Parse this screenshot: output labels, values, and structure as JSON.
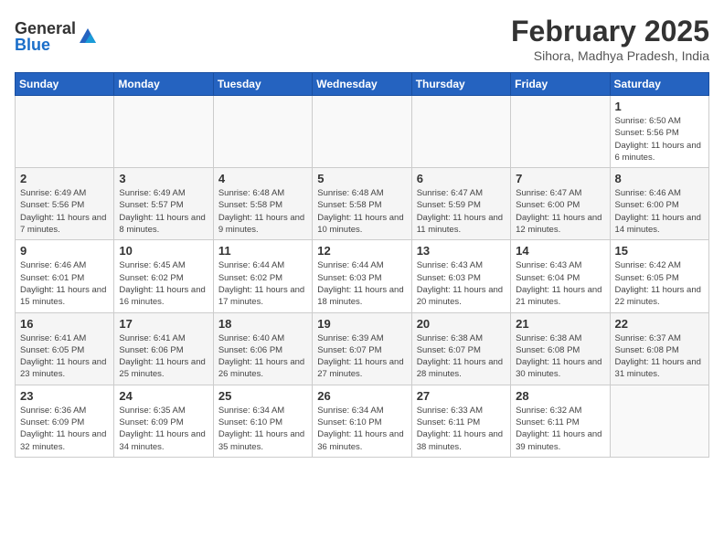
{
  "header": {
    "logo_general": "General",
    "logo_blue": "Blue",
    "month_title": "February 2025",
    "location": "Sihora, Madhya Pradesh, India"
  },
  "weekdays": [
    "Sunday",
    "Monday",
    "Tuesday",
    "Wednesday",
    "Thursday",
    "Friday",
    "Saturday"
  ],
  "weeks": [
    [
      {
        "day": "",
        "info": ""
      },
      {
        "day": "",
        "info": ""
      },
      {
        "day": "",
        "info": ""
      },
      {
        "day": "",
        "info": ""
      },
      {
        "day": "",
        "info": ""
      },
      {
        "day": "",
        "info": ""
      },
      {
        "day": "1",
        "info": "Sunrise: 6:50 AM\nSunset: 5:56 PM\nDaylight: 11 hours and 6 minutes."
      }
    ],
    [
      {
        "day": "2",
        "info": "Sunrise: 6:49 AM\nSunset: 5:56 PM\nDaylight: 11 hours and 7 minutes."
      },
      {
        "day": "3",
        "info": "Sunrise: 6:49 AM\nSunset: 5:57 PM\nDaylight: 11 hours and 8 minutes."
      },
      {
        "day": "4",
        "info": "Sunrise: 6:48 AM\nSunset: 5:58 PM\nDaylight: 11 hours and 9 minutes."
      },
      {
        "day": "5",
        "info": "Sunrise: 6:48 AM\nSunset: 5:58 PM\nDaylight: 11 hours and 10 minutes."
      },
      {
        "day": "6",
        "info": "Sunrise: 6:47 AM\nSunset: 5:59 PM\nDaylight: 11 hours and 11 minutes."
      },
      {
        "day": "7",
        "info": "Sunrise: 6:47 AM\nSunset: 6:00 PM\nDaylight: 11 hours and 12 minutes."
      },
      {
        "day": "8",
        "info": "Sunrise: 6:46 AM\nSunset: 6:00 PM\nDaylight: 11 hours and 14 minutes."
      }
    ],
    [
      {
        "day": "9",
        "info": "Sunrise: 6:46 AM\nSunset: 6:01 PM\nDaylight: 11 hours and 15 minutes."
      },
      {
        "day": "10",
        "info": "Sunrise: 6:45 AM\nSunset: 6:02 PM\nDaylight: 11 hours and 16 minutes."
      },
      {
        "day": "11",
        "info": "Sunrise: 6:44 AM\nSunset: 6:02 PM\nDaylight: 11 hours and 17 minutes."
      },
      {
        "day": "12",
        "info": "Sunrise: 6:44 AM\nSunset: 6:03 PM\nDaylight: 11 hours and 18 minutes."
      },
      {
        "day": "13",
        "info": "Sunrise: 6:43 AM\nSunset: 6:03 PM\nDaylight: 11 hours and 20 minutes."
      },
      {
        "day": "14",
        "info": "Sunrise: 6:43 AM\nSunset: 6:04 PM\nDaylight: 11 hours and 21 minutes."
      },
      {
        "day": "15",
        "info": "Sunrise: 6:42 AM\nSunset: 6:05 PM\nDaylight: 11 hours and 22 minutes."
      }
    ],
    [
      {
        "day": "16",
        "info": "Sunrise: 6:41 AM\nSunset: 6:05 PM\nDaylight: 11 hours and 23 minutes."
      },
      {
        "day": "17",
        "info": "Sunrise: 6:41 AM\nSunset: 6:06 PM\nDaylight: 11 hours and 25 minutes."
      },
      {
        "day": "18",
        "info": "Sunrise: 6:40 AM\nSunset: 6:06 PM\nDaylight: 11 hours and 26 minutes."
      },
      {
        "day": "19",
        "info": "Sunrise: 6:39 AM\nSunset: 6:07 PM\nDaylight: 11 hours and 27 minutes."
      },
      {
        "day": "20",
        "info": "Sunrise: 6:38 AM\nSunset: 6:07 PM\nDaylight: 11 hours and 28 minutes."
      },
      {
        "day": "21",
        "info": "Sunrise: 6:38 AM\nSunset: 6:08 PM\nDaylight: 11 hours and 30 minutes."
      },
      {
        "day": "22",
        "info": "Sunrise: 6:37 AM\nSunset: 6:08 PM\nDaylight: 11 hours and 31 minutes."
      }
    ],
    [
      {
        "day": "23",
        "info": "Sunrise: 6:36 AM\nSunset: 6:09 PM\nDaylight: 11 hours and 32 minutes."
      },
      {
        "day": "24",
        "info": "Sunrise: 6:35 AM\nSunset: 6:09 PM\nDaylight: 11 hours and 34 minutes."
      },
      {
        "day": "25",
        "info": "Sunrise: 6:34 AM\nSunset: 6:10 PM\nDaylight: 11 hours and 35 minutes."
      },
      {
        "day": "26",
        "info": "Sunrise: 6:34 AM\nSunset: 6:10 PM\nDaylight: 11 hours and 36 minutes."
      },
      {
        "day": "27",
        "info": "Sunrise: 6:33 AM\nSunset: 6:11 PM\nDaylight: 11 hours and 38 minutes."
      },
      {
        "day": "28",
        "info": "Sunrise: 6:32 AM\nSunset: 6:11 PM\nDaylight: 11 hours and 39 minutes."
      },
      {
        "day": "",
        "info": ""
      }
    ]
  ]
}
